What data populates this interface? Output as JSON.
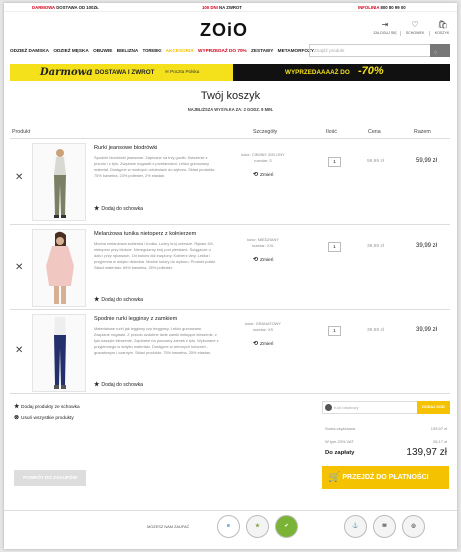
{
  "topbar": {
    "left_strong": "DARMOWA",
    "left_rest": "DOSTAWA OD 100ZŁ",
    "center_strong": "100 DNI",
    "center_rest": "NA ZWROT",
    "right_strong": "INFOLINIA",
    "right_rest": "800 80 99 00"
  },
  "header": {
    "logo": "ZOiO",
    "icons": [
      {
        "name": "user-icon",
        "glyph": "⇥",
        "label": "ZALOGUJ SIĘ"
      },
      {
        "name": "heart-icon",
        "glyph": "♡",
        "label": "SCHOWEK"
      },
      {
        "name": "basket-icon",
        "glyph": "🛍",
        "label": "KOSZYK"
      }
    ]
  },
  "nav": {
    "items": [
      "ODZIEŻ DAMSKA",
      "ODZIEŻ MĘSKA",
      "OBUWIE",
      "BIELIZNA",
      "TOREBKI",
      "AKCESORIA",
      "WYPRZEDAŻ DO 70%",
      "ZESTAWY",
      "METAMORFOZY"
    ],
    "accent_colors": {
      "AKCESORIA": "#f4c200",
      "WYPRZEDAŻ DO 70%": "#d0021b"
    },
    "search_placeholder": "Znajdź produkt"
  },
  "banners": {
    "left_script": "Darmowa",
    "left_text": "DOSTAWA I ZWROT",
    "left_partner": "Poczta Polska",
    "right_text": "WYPRZEDAAAAŻ DO",
    "right_percent": "-70%",
    "colors": {
      "yellow": "#f4e11c",
      "black": "#111111"
    }
  },
  "cart": {
    "title": "Twój koszyk",
    "shipping_note": "NAJBLIŻSZA WYSYŁKA ZA: 2 GODZ. 9 MIN.",
    "columns": [
      "Produkt",
      "Szczegóły",
      "Ilość",
      "Cena",
      "Razem"
    ],
    "items": [
      {
        "name": "Rurki jeansowe biodrówki",
        "description": "Spodnie biodrówki jeansowe. Zapinane na trzy guziki. Kieszenie z przodu i z tyłu. Zwężane nogawki z przetarciami. Lekko gumowany materiał. Dostępne w modnych odcieniach do wyboru. Skład produktu: 75% bawełna, 23% poliester, 2% elastan.",
        "color": "kolor: CIEMNY ZIELONY",
        "size": "rozmiar: S",
        "change_label": "Zmień",
        "wishlist_label": "Dodaj do schowka",
        "qty": "1",
        "price": "59,99 zł",
        "total": "59,99 zł"
      },
      {
        "name": "Melanżowa tunika nietoperz z kołnierzem",
        "description": "Modna melanżowa sukienka / tunika. Luźny krój oversize. Rękaw 3/4, nietoperz przy biuście. Nieregularny krój pod piersiami. Ściągacze u dołu i przy rękawach. Od boków dół zwężony. Kołnierz lany. Lekka i przyjemna w dotyku dzianina. Modne kolory do wyboru. Produkt polski. Skład materiału: 60% bawełna, 35% poliester.",
        "color": "kolor: MIEDZIANY",
        "size": "rozmiar: XXL",
        "change_label": "Zmień",
        "wishlist_label": "Dodaj do schowka",
        "qty": "1",
        "price": "39,99 zł",
        "total": "39,99 zł"
      },
      {
        "name": "Spodnie rurki legginsy z zamkiem",
        "description": "Materiałowe rurki jak legginsy czy tregginsy. Lekko gumowane. Zwężane nogawki. Z przodu ozdobne dwie zamki imitujące kieszenie, z tyłu naszyte kieszenie. Zapinane na ponowny zamek z tyłu. Wykonane z przyjemnego w dotyku materiału. Dostępne w ciemnych kolorach - granatowym i czarnym. Skład produktu: 75% bawełna, 25% elastan.",
        "color": "kolor: GRANATOWY",
        "size": "rozmiar: XS",
        "change_label": "Zmień",
        "wishlist_label": "Dodaj do schowka",
        "qty": "1",
        "price": "39,99 zł",
        "total": "39,99 zł"
      }
    ],
    "add_all_to_wishlist": "Dodaj produkty ze schowka",
    "remove_all": "Usuń wszystkie produkty",
    "coupon_placeholder": "Kod rabatowy",
    "coupon_button": "DODAJ KOD",
    "summary": [
      {
        "label": "Suma częściowa",
        "value": "139,97 zł"
      },
      {
        "label": "W tym 23% VAT",
        "value": "26,17 zł"
      }
    ],
    "grand_label": "Do zapłaty",
    "grand_value": "139,97 zł",
    "back_button": "POWRÓT DO ZAKUPÓW",
    "checkout_button": "PRZEJDŹ DO PŁATNOŚCI",
    "accent": "#f4c200"
  },
  "footer": {
    "trust_label": "MOŻESZ NAM ZAUFAĆ",
    "badges": [
      "e",
      "★",
      "✔",
      "✓",
      "⚓",
      "✉",
      "◎"
    ]
  }
}
